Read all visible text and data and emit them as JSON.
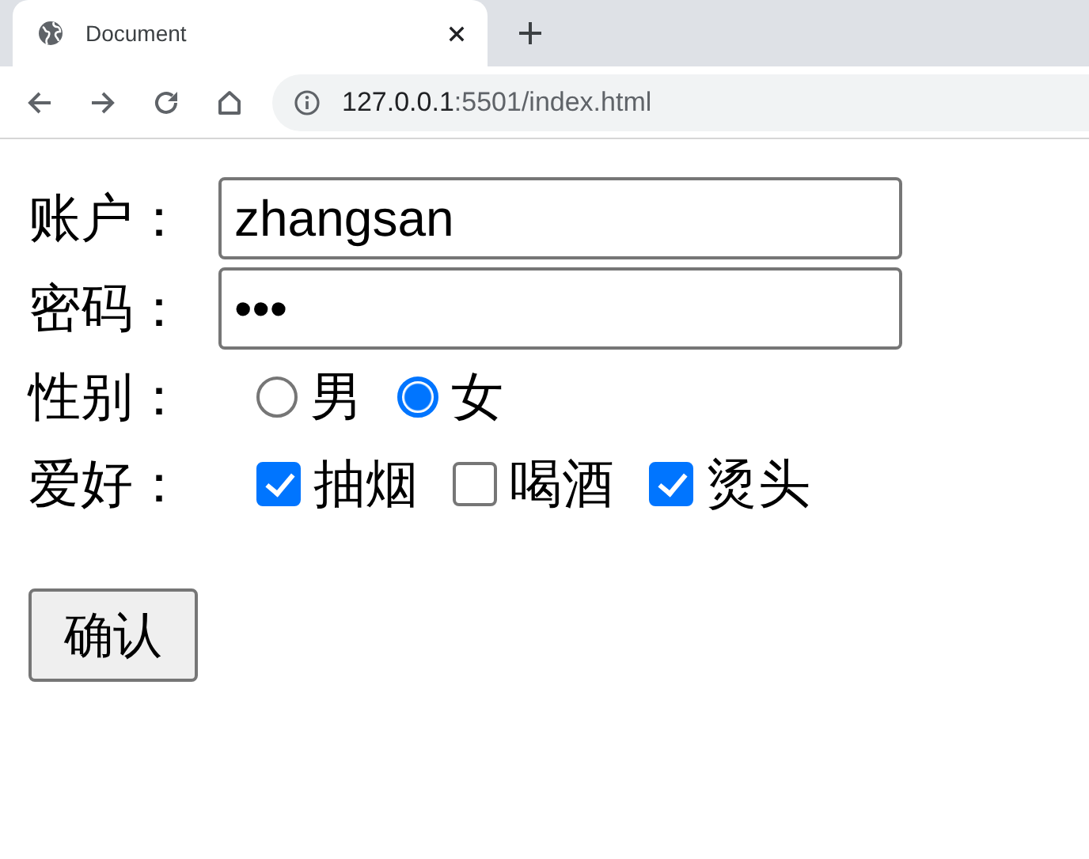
{
  "browser": {
    "tab": {
      "title": "Document"
    },
    "address": {
      "host": "127.0.0.1",
      "path": ":5501/index.html"
    }
  },
  "form": {
    "fields": [
      {
        "label": "账户：",
        "value": "zhangsan"
      },
      {
        "label": "密码：",
        "value": "•••"
      }
    ],
    "gender": {
      "label": "性别：",
      "options": [
        {
          "label": "男",
          "selected": false
        },
        {
          "label": "女",
          "selected": true
        }
      ]
    },
    "hobbies": {
      "label": "爱好：",
      "options": [
        {
          "label": "抽烟",
          "checked": true
        },
        {
          "label": "喝酒",
          "checked": false
        },
        {
          "label": "烫头",
          "checked": true
        }
      ]
    },
    "submit": "确认"
  }
}
